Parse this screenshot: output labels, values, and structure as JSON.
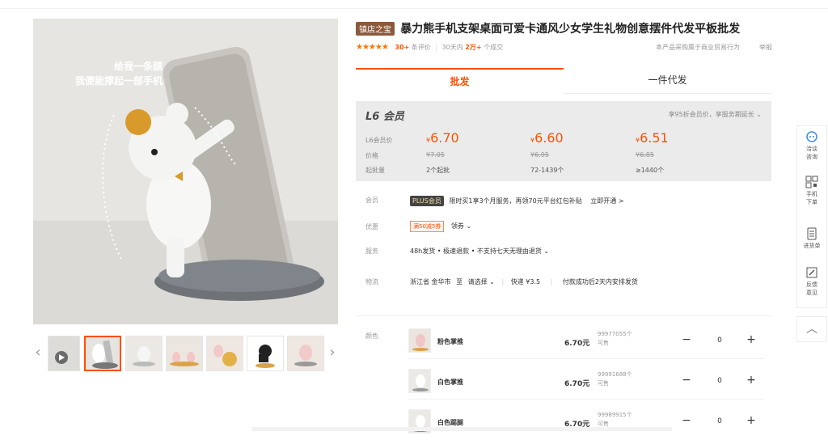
{
  "product": {
    "store_badge": "镇店之宝",
    "title": "暴力熊手机支架桌面可爱卡通风少女学生礼物创意摆件代发平板批发",
    "rating_stars": "★★★★★",
    "reviews_count": "30+",
    "reviews_label": "条评价",
    "sales_period": "30天内",
    "sales_count": "2万+",
    "sales_label": "个成交",
    "trade_note": "本产品采购属于商业贸易行为",
    "report": "举报"
  },
  "main_image": {
    "caption_line1": "给我一条腿",
    "caption_line2": "我便能撑起一部手机"
  },
  "thumbnails": {
    "prev": "‹",
    "next": "›",
    "count": 7
  },
  "tabs": [
    {
      "label": "批发",
      "active": true
    },
    {
      "label": "一件代发",
      "active": false
    }
  ],
  "pricing": {
    "header": "L6 会员",
    "header_note": "享95折会员价，享服务期延长",
    "row_labels": [
      "L6会员价",
      "价格",
      "起批量"
    ],
    "currency": "¥",
    "tiers": [
      {
        "member": "6.70",
        "old": "¥7.05",
        "qty": "2个起批"
      },
      {
        "member": "6.60",
        "old": "¥6.95",
        "qty": "72-1439个"
      },
      {
        "member": "6.51",
        "old": "¥6.85",
        "qty": "≥1440个"
      }
    ]
  },
  "info": {
    "member_label": "会员",
    "plus_badge": "PLUS会员",
    "plus_text": "限时买1享3个月服务，再领70元平台红包补贴",
    "plus_link": "立即开通 >",
    "discount_label": "优惠",
    "coupon": "满50减5券",
    "coupon_link": "领券 ⌄",
    "service_label": "服务",
    "service_text": "48h发货 • 极速退款 • 不支持七天无理由退货 ⌄",
    "logistics_label": "物流",
    "logistics_from": "浙江省 金华市",
    "logistics_to": "至",
    "logistics_select": "请选择 ⌄",
    "logistics_express": "快递 ¥3.5",
    "logistics_note": "付款成功后2天内安排发货"
  },
  "sku": {
    "label": "颜色",
    "items": [
      {
        "name": "粉色掌推",
        "price": "6.70元",
        "stock_line1": "99977055个",
        "stock_line2": "可售",
        "qty": "0"
      },
      {
        "name": "白色掌推",
        "price": "6.70元",
        "stock_line1": "99991688个",
        "stock_line2": "可售",
        "qty": "0"
      },
      {
        "name": "白色踢腿",
        "price": "6.70元",
        "stock_line1": "99989915个",
        "stock_line2": "可售",
        "qty": "0"
      }
    ],
    "minus": "−",
    "plus": "+"
  },
  "sidebar": {
    "items": [
      {
        "label": "洽谈咨询",
        "icon": "chat-icon"
      },
      {
        "label": "手机下单",
        "icon": "qrcode-icon"
      },
      {
        "label": "进货单",
        "icon": "list-icon"
      },
      {
        "label": "反馈意见",
        "icon": "feedback-icon"
      }
    ],
    "top": "︿"
  },
  "colors": {
    "accent": "#ff5000",
    "badge": "#8b5a3c",
    "price_box": "#ebebeb"
  }
}
